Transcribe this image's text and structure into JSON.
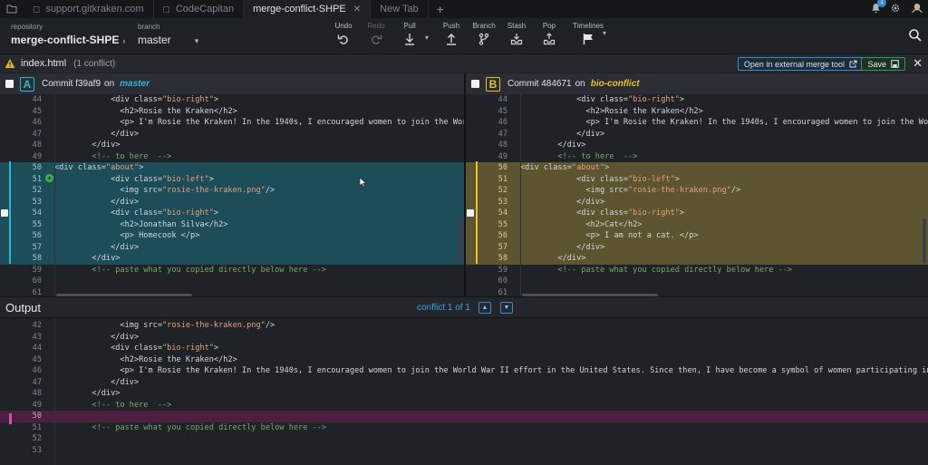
{
  "tabs": [
    {
      "label": "support.gitkraken.com",
      "active": false
    },
    {
      "label": "CodeCapitan",
      "active": false
    },
    {
      "label": "merge-conflict-SHPE",
      "active": true
    },
    {
      "label": "New Tab",
      "active": false
    }
  ],
  "notifications": {
    "count": "1"
  },
  "toolbar": {
    "repo_label": "repository",
    "repo_value": "merge-conflict-SHPE",
    "branch_label": "branch",
    "branch_value": "master",
    "undo": "Undo",
    "redo": "Redo",
    "pull": "Pull",
    "push": "Push",
    "branch_btn": "Branch",
    "stash": "Stash",
    "pop": "Pop",
    "timelines": "Timelines"
  },
  "file": {
    "name": "index.html",
    "conflicts": "(1 conflict)",
    "open_external": "Open in external merge tool",
    "save": "Save"
  },
  "pane_a": {
    "badge": "A",
    "commit": "Commit f39af9",
    "on": "on",
    "branch": "master",
    "lines": [
      {
        "n": "44",
        "t": "            <div class=\"bio-right\">",
        "k": "tag"
      },
      {
        "n": "45",
        "t": "              <h2>Rosie the Kraken</h2>",
        "k": "tag"
      },
      {
        "n": "46",
        "t": "              <p> I'm Rosie the Kraken! In the 1940s, I encouraged women to join the World War",
        "k": "tag"
      },
      {
        "n": "47",
        "t": "            </div>",
        "k": "tag"
      },
      {
        "n": "48",
        "t": "        </div>",
        "k": "tag"
      },
      {
        "n": "49",
        "t": "        <!-- to here  -->",
        "k": "comment"
      },
      {
        "n": "50",
        "t": "<div class=\"about\">",
        "k": "tag"
      },
      {
        "n": "51",
        "t": "            <div class=\"bio-left\">",
        "k": "tag"
      },
      {
        "n": "52",
        "t": "              <img src=\"rosie-the-kraken.png\"/>",
        "k": "tag"
      },
      {
        "n": "53",
        "t": "            </div>",
        "k": "tag"
      },
      {
        "n": "54",
        "t": "            <div class=\"bio-right\">",
        "k": "tag"
      },
      {
        "n": "55",
        "t": "              <h2>Jonathan Silva</h2>",
        "k": "tag"
      },
      {
        "n": "56",
        "t": "              <p> Homecook </p>",
        "k": "tag"
      },
      {
        "n": "57",
        "t": "            </div>",
        "k": "tag"
      },
      {
        "n": "58",
        "t": "        </div>",
        "k": "tag"
      },
      {
        "n": "59",
        "t": "        <!-- paste what you copied directly below here -->",
        "k": "comment"
      },
      {
        "n": "60",
        "t": "",
        "k": "tag"
      },
      {
        "n": "61",
        "t": "",
        "k": "tag"
      }
    ]
  },
  "pane_b": {
    "badge": "B",
    "commit": "Commit 484671",
    "on": "on",
    "branch": "bio-conflict",
    "lines": [
      {
        "n": "44",
        "t": "            <div class=\"bio-right\">",
        "k": "tag"
      },
      {
        "n": "45",
        "t": "              <h2>Rosie the Kraken</h2>",
        "k": "tag"
      },
      {
        "n": "46",
        "t": "              <p> I'm Rosie the Kraken! In the 1940s, I encouraged women to join the World War",
        "k": "tag"
      },
      {
        "n": "47",
        "t": "            </div>",
        "k": "tag"
      },
      {
        "n": "48",
        "t": "        </div>",
        "k": "tag"
      },
      {
        "n": "49",
        "t": "        <!-- to here  -->",
        "k": "comment"
      },
      {
        "n": "50",
        "t": "<div class=\"about\">",
        "k": "tag"
      },
      {
        "n": "51",
        "t": "            <div class=\"bio-left\">",
        "k": "tag"
      },
      {
        "n": "52",
        "t": "              <img src=\"rosie-the-kraken.png\"/>",
        "k": "tag"
      },
      {
        "n": "53",
        "t": "            </div>",
        "k": "tag"
      },
      {
        "n": "54",
        "t": "            <div class=\"bio-right\">",
        "k": "tag"
      },
      {
        "n": "55",
        "t": "              <h2>Cat</h2>",
        "k": "tag"
      },
      {
        "n": "56",
        "t": "              <p> I am not a cat. </p>",
        "k": "tag"
      },
      {
        "n": "57",
        "t": "            </div>",
        "k": "tag"
      },
      {
        "n": "58",
        "t": "        </div>",
        "k": "tag"
      },
      {
        "n": "59",
        "t": "        <!-- paste what you copied directly below here -->",
        "k": "comment"
      },
      {
        "n": "60",
        "t": "",
        "k": "tag"
      },
      {
        "n": "61",
        "t": "",
        "k": "tag"
      }
    ]
  },
  "output": {
    "title": "Output",
    "conflict_label": "conflict 1 of 1",
    "lines": [
      {
        "n": "42",
        "t": "              <img src=\"rosie-the-kraken.png\"/>",
        "k": "tag"
      },
      {
        "n": "43",
        "t": "            </div>",
        "k": "tag"
      },
      {
        "n": "44",
        "t": "            <div class=\"bio-right\">",
        "k": "tag"
      },
      {
        "n": "45",
        "t": "              <h2>Rosie the Kraken</h2>",
        "k": "tag"
      },
      {
        "n": "46",
        "t": "              <p> I'm Rosie the Kraken! In the 1940s, I encouraged women to join the World War II effort in the United States. Since then, I have become a symbol of women participating in all sort",
        "k": "tag"
      },
      {
        "n": "47",
        "t": "            </div>",
        "k": "tag"
      },
      {
        "n": "48",
        "t": "        </div>",
        "k": "tag"
      },
      {
        "n": "49",
        "t": "        <!-- to here  -->",
        "k": "comment"
      },
      {
        "n": "50",
        "t": "",
        "k": "tag"
      },
      {
        "n": "51",
        "t": "        <!-- paste what you copied directly below here -->",
        "k": "comment"
      },
      {
        "n": "52",
        "t": "",
        "k": "tag"
      },
      {
        "n": "53",
        "t": "",
        "k": "tag"
      }
    ]
  },
  "colors": {
    "accent_a": "#29b7d6",
    "accent_b": "#e8c02c",
    "conflict_marker": "#d64fb5"
  }
}
